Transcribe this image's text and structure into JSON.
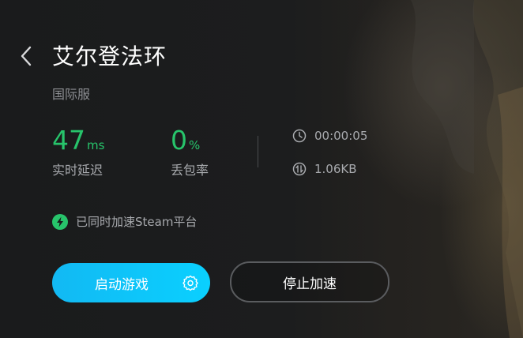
{
  "game": {
    "title": "艾尔登法环",
    "server": "国际服"
  },
  "stats": {
    "latency_value": "47",
    "latency_unit": "ms",
    "latency_label": "实时延迟",
    "loss_value": "0",
    "loss_unit": "%",
    "loss_label": "丢包率"
  },
  "session": {
    "duration": "00:00:05",
    "traffic": "1.06KB"
  },
  "steam_note": "已同时加速Steam平台",
  "buttons": {
    "launch_label": "启动游戏",
    "stop_label": "停止加速"
  },
  "icons": {
    "back": "chevron-left-icon",
    "clock": "clock-icon",
    "traffic": "transfer-icon",
    "lightning": "lightning-icon",
    "settings": "gear-icon"
  },
  "colors": {
    "accent_green": "#27c46b",
    "launch_blue": "#0ad0ff",
    "background": "#1b1c1d"
  }
}
